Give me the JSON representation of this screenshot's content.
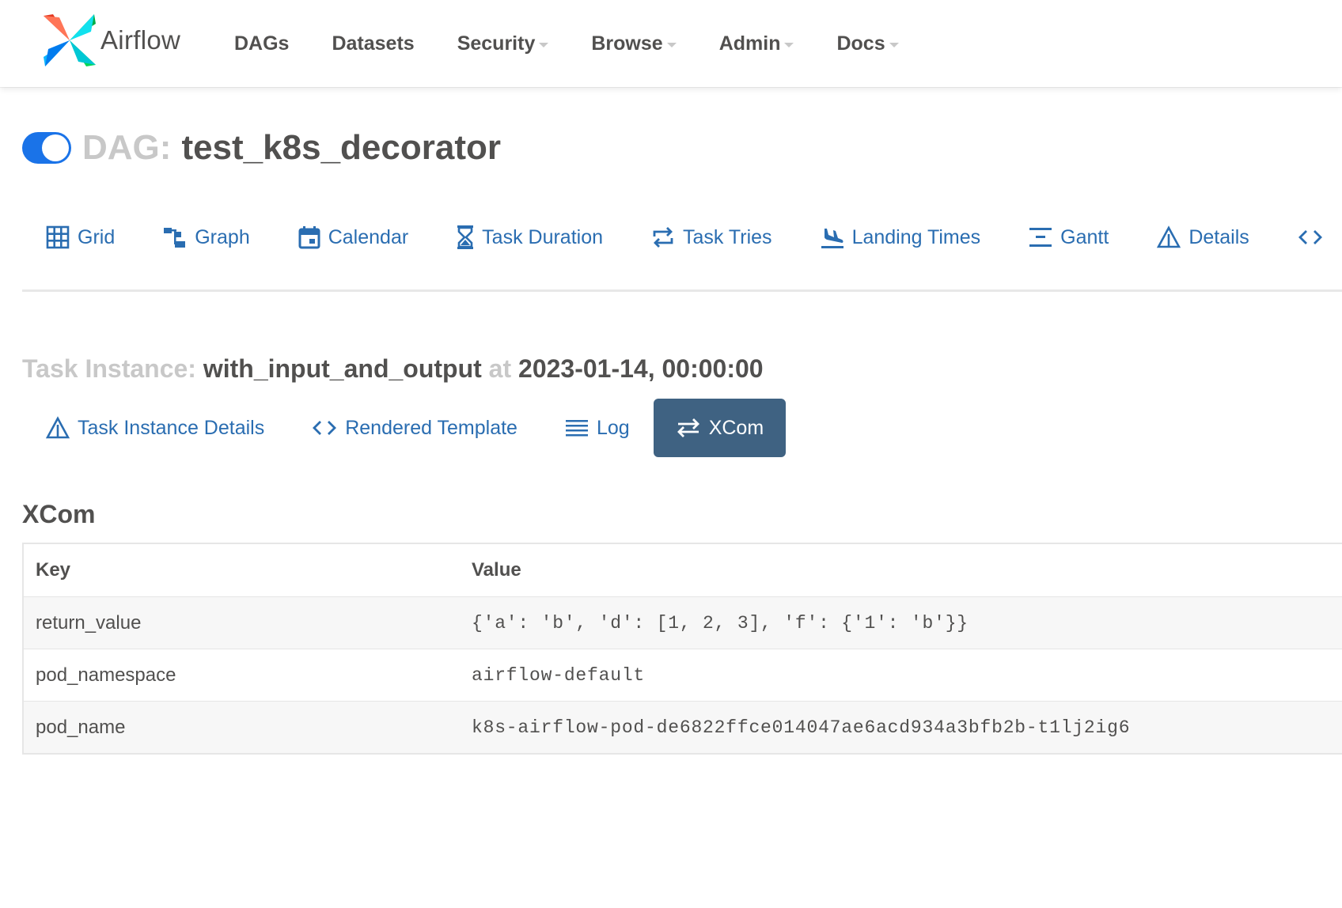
{
  "app": {
    "brand": "Airflow"
  },
  "nav": {
    "items": [
      {
        "label": "DAGs",
        "dropdown": false
      },
      {
        "label": "Datasets",
        "dropdown": false
      },
      {
        "label": "Security",
        "dropdown": true
      },
      {
        "label": "Browse",
        "dropdown": true
      },
      {
        "label": "Admin",
        "dropdown": true
      },
      {
        "label": "Docs",
        "dropdown": true
      }
    ]
  },
  "dag": {
    "prefix": "DAG:",
    "name": "test_k8s_decorator",
    "enabled": true
  },
  "view_tabs": [
    {
      "label": "Grid",
      "icon": "grid-icon"
    },
    {
      "label": "Graph",
      "icon": "graph-icon"
    },
    {
      "label": "Calendar",
      "icon": "calendar-icon"
    },
    {
      "label": "Task Duration",
      "icon": "hourglass-icon"
    },
    {
      "label": "Task Tries",
      "icon": "retry-icon"
    },
    {
      "label": "Landing Times",
      "icon": "plane-landing-icon"
    },
    {
      "label": "Gantt",
      "icon": "gantt-icon"
    },
    {
      "label": "Details",
      "icon": "warning-triangle-icon"
    },
    {
      "label": "",
      "icon": "code-icon"
    }
  ],
  "task_instance": {
    "prefix": "Task Instance:",
    "task_id": "with_input_and_output",
    "at_label": "at",
    "execution_date": "2023-01-14, 00:00:00"
  },
  "ti_tabs": [
    {
      "label": "Task Instance Details",
      "icon": "warning-triangle-icon",
      "active": false
    },
    {
      "label": "Rendered Template",
      "icon": "code-icon",
      "active": false
    },
    {
      "label": "Log",
      "icon": "list-icon",
      "active": false
    },
    {
      "label": "XCom",
      "icon": "exchange-icon",
      "active": true
    }
  ],
  "xcom": {
    "title": "XCom",
    "headers": {
      "key": "Key",
      "value": "Value"
    },
    "rows": [
      {
        "key": "return_value",
        "value": "{'a': 'b', 'd': [1, 2, 3], 'f': {'1': 'b'}}"
      },
      {
        "key": "pod_namespace",
        "value": "airflow-default"
      },
      {
        "key": "pod_name",
        "value": "k8s-airflow-pod-de6822ffce014047ae6acd934a3bfb2b-t1lj2ig6"
      }
    ]
  },
  "colors": {
    "link": "#2a6db1",
    "active_tab_bg": "#3f6282",
    "toggle_on": "#1a73e8",
    "muted_text": "#c8c8c8",
    "body_text": "#51504f"
  }
}
